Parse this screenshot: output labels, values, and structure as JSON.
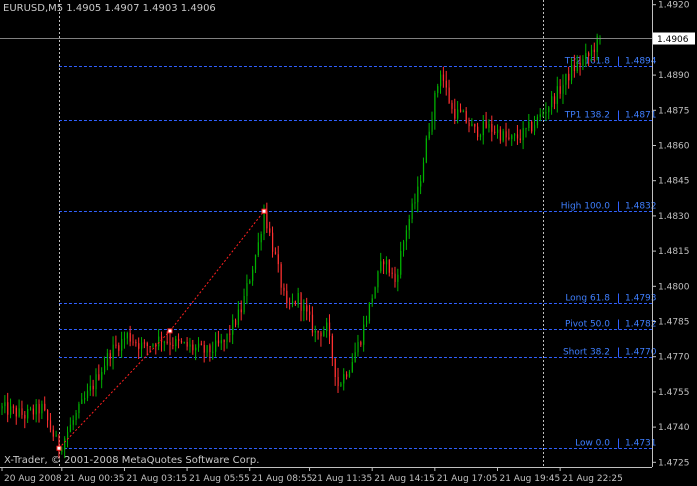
{
  "header": {
    "symbol_info": "EURUSD,M5  1.4905 1.4907 1.4903 1.4906"
  },
  "footer": {
    "copyright": "X-Trader, © 2001-2008 MetaQuotes Software Corp."
  },
  "colors": {
    "background": "#000000",
    "bull_candle": "#00b000",
    "bear_candle": "#ff3030",
    "fib_line": "#3060ff",
    "fib_text": "#3f7fff",
    "axis": "#c0c0c0",
    "grid_vertical": "#bfbfbf",
    "price_badge_bg": "#ffffff",
    "zigzag": "#ff2020"
  },
  "chart_data": {
    "type": "candlestick",
    "symbol": "EURUSD",
    "timeframe": "M5",
    "last_bar": {
      "open": 1.4905,
      "high": 1.4907,
      "low": 1.4903,
      "close": 1.4906
    },
    "current_price": "1.4906",
    "ylim": [
      1.4723,
      1.4922
    ],
    "price_ticks": [
      "1.4920",
      "1.4905",
      "1.4890",
      "1.4875",
      "1.4860",
      "1.4845",
      "1.4830",
      "1.4815",
      "1.4800",
      "1.4785",
      "1.4770",
      "1.4755",
      "1.4740",
      "1.4725"
    ],
    "time_ticks": [
      "20 Aug 2008",
      "21 Aug 00:35",
      "21 Aug 03:15",
      "21 Aug 05:55",
      "21 Aug 08:55",
      "21 Aug 11:35",
      "21 Aug 14:15",
      "21 Aug 17:05",
      "21 Aug 19:45",
      "21 Aug 22:25"
    ],
    "fib_levels": [
      {
        "name": "TP2",
        "ratio": "161.8",
        "price": "1.4894"
      },
      {
        "name": "TP1",
        "ratio": "138.2",
        "price": "1.4871"
      },
      {
        "name": "High",
        "ratio": "100.0",
        "price": "1.4832"
      },
      {
        "name": "Long",
        "ratio": "61.8",
        "price": "1.4793"
      },
      {
        "name": "Pivot",
        "ratio": "50.0",
        "price": "1.4782"
      },
      {
        "name": "Short",
        "ratio": "38.2",
        "price": "1.4770"
      },
      {
        "name": "Low",
        "ratio": "0.0",
        "price": "1.4731"
      }
    ],
    "zigzag_points": [
      {
        "bar": 20,
        "price": 1.4731
      },
      {
        "bar": 59,
        "price": 1.4781
      },
      {
        "bar": 92,
        "price": 1.4832
      }
    ],
    "price_path": [
      [
        0,
        1.4748
      ],
      [
        8,
        1.4745
      ],
      [
        14,
        1.4748
      ],
      [
        20,
        1.4731
      ],
      [
        26,
        1.4745
      ],
      [
        32,
        1.4758
      ],
      [
        38,
        1.4772
      ],
      [
        44,
        1.4779
      ],
      [
        50,
        1.4774
      ],
      [
        56,
        1.4778
      ],
      [
        60,
        1.4776
      ],
      [
        66,
        1.4774
      ],
      [
        72,
        1.4772
      ],
      [
        78,
        1.4776
      ],
      [
        84,
        1.479
      ],
      [
        90,
        1.4818
      ],
      [
        92,
        1.4832
      ],
      [
        96,
        1.4812
      ],
      [
        100,
        1.479
      ],
      [
        104,
        1.4795
      ],
      [
        110,
        1.478
      ],
      [
        114,
        1.4782
      ],
      [
        118,
        1.4758
      ],
      [
        122,
        1.4766
      ],
      [
        126,
        1.4778
      ],
      [
        130,
        1.4796
      ],
      [
        134,
        1.4812
      ],
      [
        138,
        1.4802
      ],
      [
        142,
        1.4825
      ],
      [
        146,
        1.484
      ],
      [
        150,
        1.4868
      ],
      [
        154,
        1.4892
      ],
      [
        158,
        1.4875
      ],
      [
        162,
        1.4872
      ],
      [
        166,
        1.4866
      ],
      [
        170,
        1.4868
      ],
      [
        174,
        1.4866
      ],
      [
        178,
        1.4862
      ],
      [
        182,
        1.4864
      ],
      [
        186,
        1.4868
      ],
      [
        190,
        1.4874
      ],
      [
        196,
        1.4884
      ],
      [
        200,
        1.4892
      ],
      [
        206,
        1.4898
      ],
      [
        210,
        1.4906
      ]
    ],
    "bar_count": 211,
    "grid": "vertical dotted at session separators"
  }
}
